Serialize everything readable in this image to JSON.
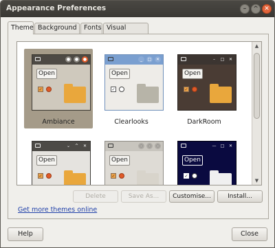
{
  "window": {
    "title": "Appearance Preferences",
    "controls": {
      "minimize": "–",
      "maximize": "^",
      "close": "✕"
    }
  },
  "tabs": [
    {
      "label": "Theme",
      "active": true
    },
    {
      "label": "Background",
      "active": false
    },
    {
      "label": "Fonts",
      "active": false
    },
    {
      "label": "Visual Effects",
      "active": false
    }
  ],
  "themes": [
    {
      "name": "Ambiance",
      "selected": true,
      "open_label": "Open",
      "bar": "#4d4944",
      "body": "#cfc9bd",
      "border": "#3a3731",
      "folder": "#e9a73c",
      "controls": [
        "●",
        "●",
        "●"
      ],
      "dot_colors": [
        "#8b8780",
        "#8b8780",
        "#e05a28"
      ]
    },
    {
      "name": "Clearlooks",
      "selected": false,
      "open_label": "Open",
      "bar": "#7a9fd0",
      "body": "#eeece8",
      "border": "#6f8fba",
      "folder": "#b7b4a8",
      "controls": [
        "_",
        "□",
        "✕"
      ],
      "dot_colors": [
        "#8aaad6",
        "#8aaad6",
        "#8aaad6"
      ]
    },
    {
      "name": "DarkRoom",
      "selected": false,
      "open_label": "Open",
      "bar": "#3c3531",
      "body": "#4a3c34",
      "border": "#2a2420",
      "folder": "#e9a73c",
      "controls": [
        "–",
        "□",
        "✕"
      ],
      "dot_colors": [
        "#3c3531",
        "#3c3531",
        "#3c3531"
      ]
    },
    {
      "name": "",
      "selected": false,
      "open_label": "Open",
      "bar": "#4c4a46",
      "body": "#e5e3df",
      "border": "#3b3936",
      "folder": "#e9a73c",
      "controls": [
        "⌄",
        "^",
        "✕"
      ],
      "dot_colors": [
        "#4c4a46",
        "#4c4a46",
        "#4c4a46"
      ]
    },
    {
      "name": "",
      "selected": false,
      "open_label": "Open",
      "bar": "#c8c5be",
      "body": "#dedbd5",
      "border": "#8f8c86",
      "folder": "#d8d4cb",
      "controls": [
        "○",
        "○",
        "○"
      ],
      "dot_colors": [
        "#aeaba5",
        "#aeaba5",
        "#aeaba5"
      ]
    },
    {
      "name": "",
      "selected": false,
      "open_label": "Open",
      "bar": "#0a0a40",
      "body": "#0a0a40",
      "border": "#000010",
      "folder": "#f0f0f0",
      "controls": [
        "—",
        "□",
        "✕"
      ],
      "dot_colors": [
        "#0a0a40",
        "#0a0a40",
        "#0a0a40"
      ]
    }
  ],
  "actions": {
    "delete": "Delete",
    "save_as": "Save As...",
    "customise": "Customise...",
    "install": "Install..."
  },
  "more_themes_link": "Get more themes online",
  "footer": {
    "help": "Help",
    "close": "Close"
  },
  "scrollbar": {
    "up": "▲",
    "down": "▼"
  },
  "colors": {
    "accent": "#a59b89",
    "link": "#1d3ea8",
    "close_button": "#e2643b"
  }
}
